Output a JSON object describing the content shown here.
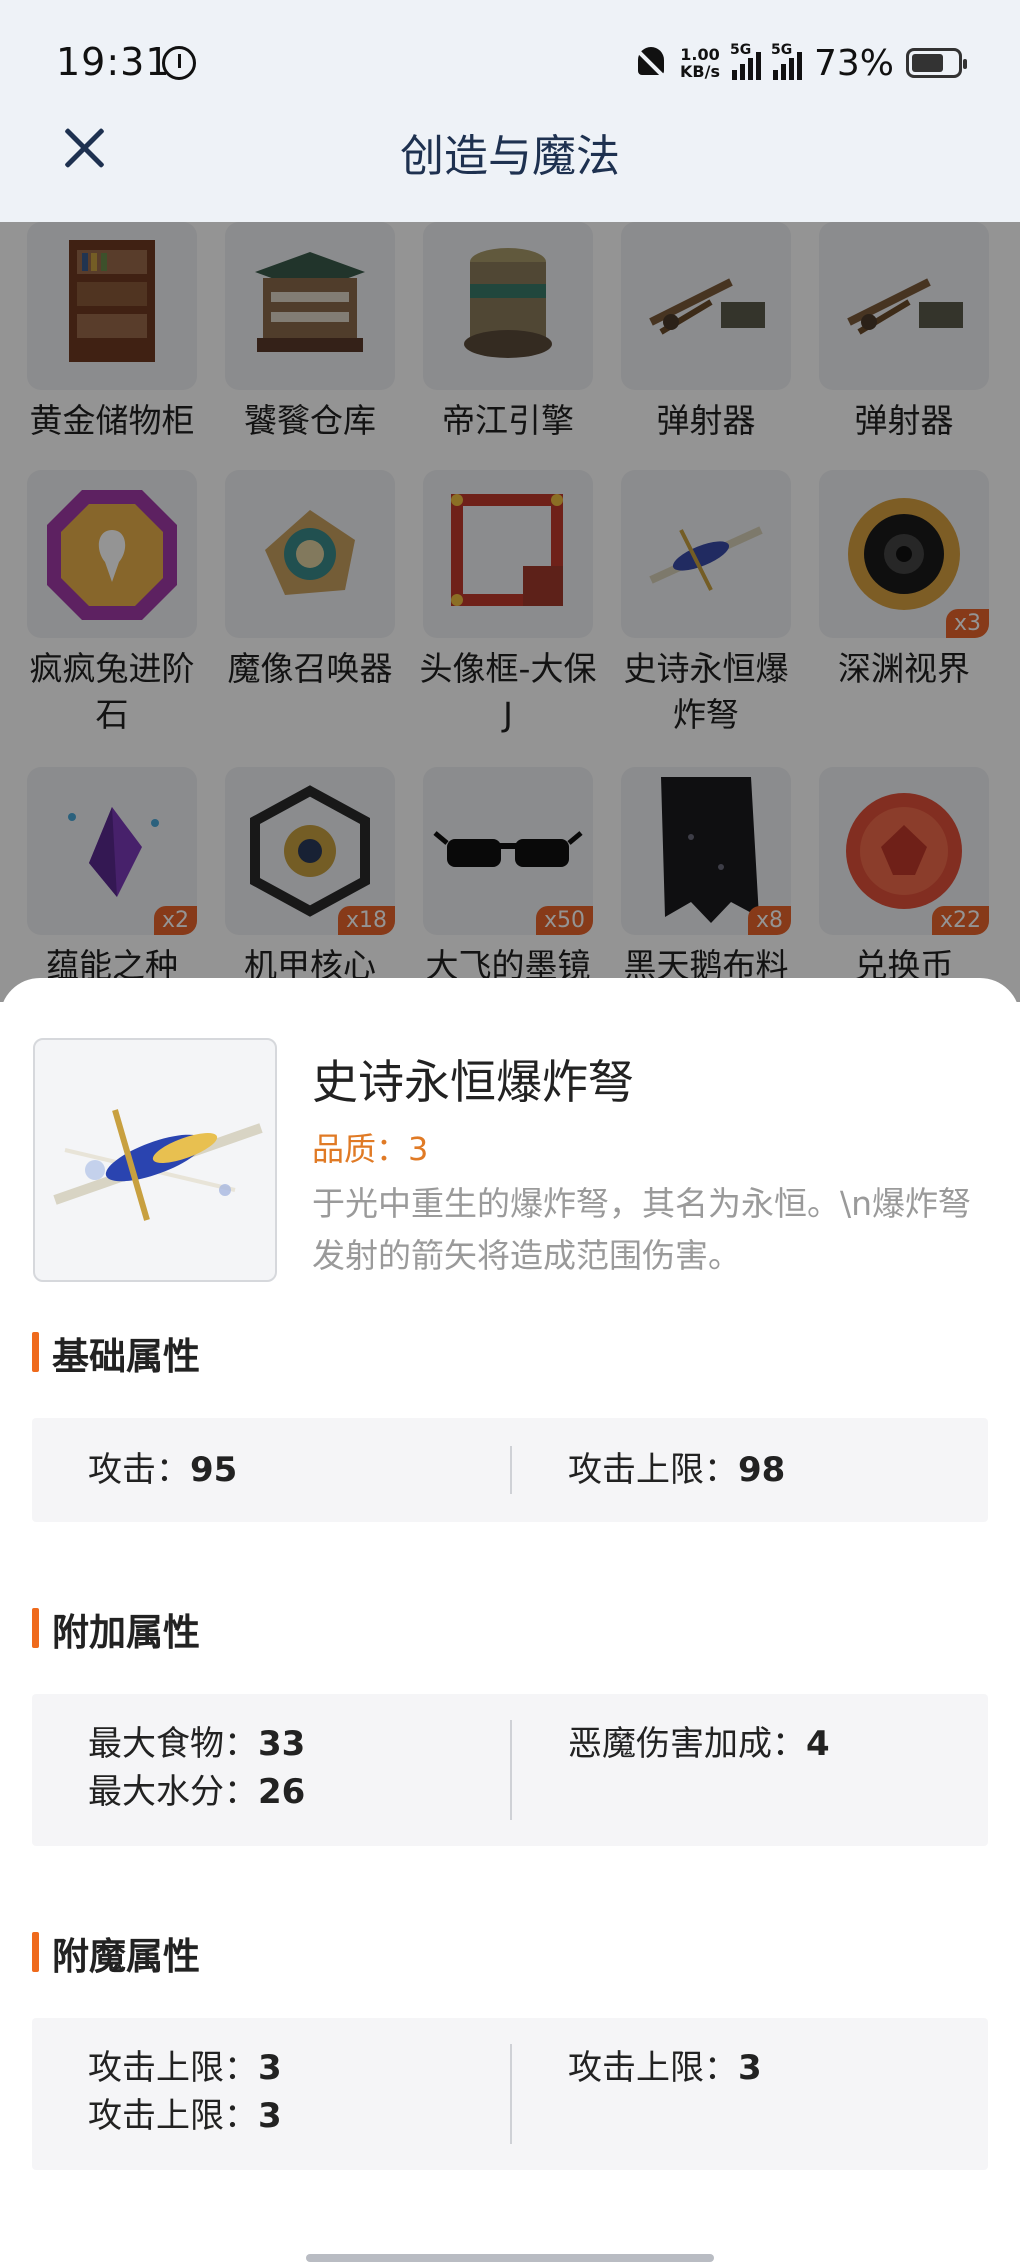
{
  "status_bar": {
    "time": "19:31",
    "net_speed_value": "1.00",
    "net_speed_unit": "KB/s",
    "sig1_label": "5G",
    "sig2_label": "5G",
    "battery": "73%"
  },
  "header": {
    "title": "创造与魔法"
  },
  "grid": {
    "items": [
      {
        "name": "黄金储物柜",
        "badge": ""
      },
      {
        "name": "饕餮仓库",
        "badge": ""
      },
      {
        "name": "帝江引擎",
        "badge": ""
      },
      {
        "name": "弹射器",
        "badge": ""
      },
      {
        "name": "弹射器",
        "badge": ""
      },
      {
        "name": "疯疯兔进阶石",
        "badge": ""
      },
      {
        "name": "魔像召唤器",
        "badge": ""
      },
      {
        "name": "头像框-大保J",
        "badge": ""
      },
      {
        "name": "史诗永恒爆炸弩",
        "badge": ""
      },
      {
        "name": "深渊视界",
        "badge": "x3"
      },
      {
        "name": "蕴能之种",
        "badge": "x2"
      },
      {
        "name": "机甲核心",
        "badge": "x18"
      },
      {
        "name": "大飞的墨镜",
        "badge": "x50"
      },
      {
        "name": "黑天鹅布料",
        "badge": "x8"
      },
      {
        "name": "兑换币",
        "badge": "x22"
      }
    ]
  },
  "detail": {
    "title": "史诗永恒爆炸弩",
    "quality_label": "品质：",
    "quality_value": "3",
    "description": "于光中重生的爆炸弩，其名为永恒。\\n爆炸弩发射的箭矢将造成范围伤害。",
    "base": {
      "heading": "基础属性",
      "left": [
        {
          "label": "攻击：",
          "value": "95"
        }
      ],
      "right": [
        {
          "label": "攻击上限：",
          "value": "98"
        }
      ]
    },
    "extra": {
      "heading": "附加属性",
      "left": [
        {
          "label": "最大食物：",
          "value": "33"
        },
        {
          "label": "最大水分：",
          "value": "26"
        }
      ],
      "right": [
        {
          "label": "恶魔伤害加成：",
          "value": "4"
        }
      ]
    },
    "enchant": {
      "heading": "附魔属性",
      "left": [
        {
          "label": "攻击上限：",
          "value": "3"
        },
        {
          "label": "攻击上限：",
          "value": "3"
        }
      ],
      "right": [
        {
          "label": "攻击上限：",
          "value": "3"
        }
      ]
    }
  },
  "colors": {
    "accent": "#ef6a1c",
    "quality": "#e07a25",
    "badge": "#e8642b",
    "header_text": "#1e3150"
  }
}
